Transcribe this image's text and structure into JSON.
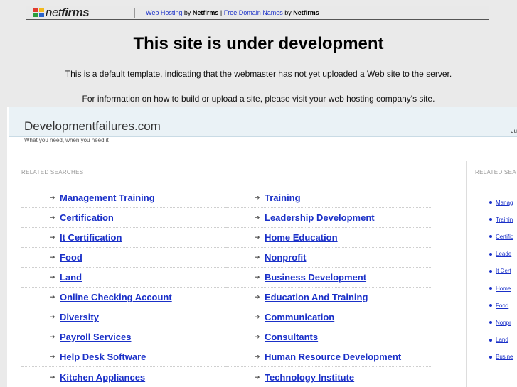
{
  "top_bar": {
    "logo_text_light": "net",
    "logo_text_bold": "firms",
    "link1": "Web Hosting",
    "by1": " by ",
    "brand1": "Netfirms",
    "sep": " | ",
    "link2": "Free Domain Names",
    "by2": " by ",
    "brand2": "Netfirms"
  },
  "notice": {
    "title": "This site is under development",
    "line1": "This is a default template, indicating that the webmaster has not yet uploaded a Web site to the server.",
    "line2": "For information on how to build or upload a site, please visit your web hosting company's site."
  },
  "site": {
    "name": "Developmentfailures.com",
    "tagline": "What you need, when you need it",
    "right_text": "Ju",
    "related_label": "RELATED SEARCHES",
    "side_label": "RELATED SEA",
    "left_links": [
      "Management Training",
      "Certification",
      "It Certification",
      "Food",
      "Land",
      "Online Checking Account",
      "Diversity",
      "Payroll Services",
      "Help Desk Software",
      "Kitchen Appliances"
    ],
    "right_links": [
      "Training",
      "Leadership Development",
      "Home Education",
      "Nonprofit",
      "Business Development",
      "Education And Training",
      "Communication",
      "Consultants",
      "Human Resource Development",
      "Technology Institute"
    ],
    "side_links": [
      "Manag",
      "Trainin",
      "Certific",
      "Leade",
      "It Cert",
      "Home",
      "Food",
      "Nonpr",
      "Land",
      "Busine"
    ]
  },
  "colors": {
    "link": "#1a30c8",
    "header_bg": "#eaf2f6",
    "page_bg": "#eaeaea"
  }
}
